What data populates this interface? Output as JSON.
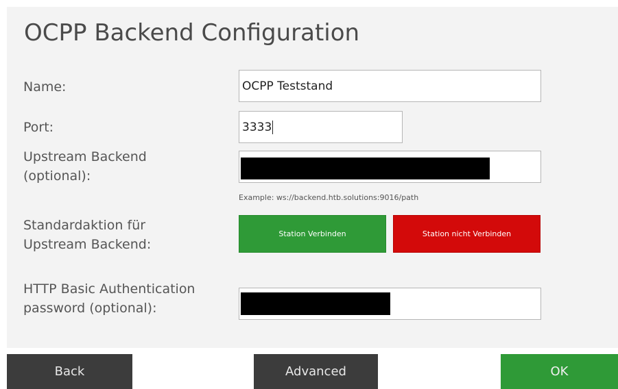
{
  "page": {
    "title": "OCPP Backend Configuration"
  },
  "form": {
    "name_label": "Name:",
    "name_value": "OCPP Teststand",
    "port_label": "Port:",
    "port_value": "3333",
    "upstream_label_line1": "Upstream Backend",
    "upstream_label_line2": "(optional):",
    "upstream_value": "[redacted]",
    "upstream_example": "Example: ws://backend.htb.solutions:9016/path",
    "default_action_label_line1": "Standardaktion für",
    "default_action_label_line2": "Upstream Backend:",
    "connect_label": "Station Verbinden",
    "no_connect_label": "Station nicht Verbinden",
    "auth_label_line1": "HTTP Basic Authentication",
    "auth_label_line2": "password (optional):",
    "auth_value": "[redacted]"
  },
  "footer": {
    "back_label": "Back",
    "advanced_label": "Advanced",
    "ok_label": "OK"
  },
  "colors": {
    "accent_green": "#2f9a37",
    "danger_red": "#d30a0a",
    "dark_button": "#3c3c3c",
    "panel_background": "#f3f3f3"
  }
}
